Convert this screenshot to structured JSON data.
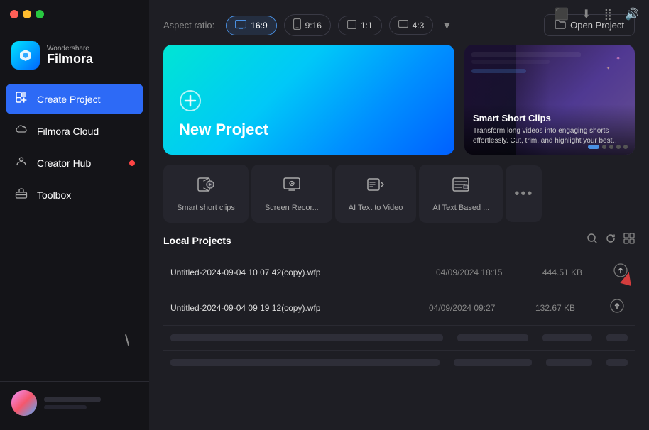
{
  "app": {
    "title": "Wondershare Filmora",
    "brand": "Wondershare",
    "product": "Filmora"
  },
  "titlebar": {
    "buttons": [
      "close",
      "minimize",
      "maximize"
    ]
  },
  "topRightIcons": [
    "screen-mirror-icon",
    "download-icon",
    "grid-icon",
    "settings-icon"
  ],
  "sidebar": {
    "items": [
      {
        "id": "create-project",
        "label": "Create Project",
        "icon": "➕",
        "active": true
      },
      {
        "id": "filmora-cloud",
        "label": "Filmora Cloud",
        "icon": "☁️",
        "active": false
      },
      {
        "id": "creator-hub",
        "label": "Creator Hub",
        "icon": "👤",
        "active": false,
        "badge": true
      },
      {
        "id": "toolbox",
        "label": "Toolbox",
        "icon": "🧰",
        "active": false
      }
    ]
  },
  "aspectRatio": {
    "label": "Aspect ratio:",
    "options": [
      {
        "id": "16-9",
        "label": "16:9",
        "active": true
      },
      {
        "id": "9-16",
        "label": "9:16",
        "active": false
      },
      {
        "id": "1-1",
        "label": "1:1",
        "active": false
      },
      {
        "id": "4-3",
        "label": "4:3",
        "active": false
      }
    ],
    "more": "▾"
  },
  "openProject": {
    "label": "Open Project",
    "icon": "📁"
  },
  "newProject": {
    "title": "New Project",
    "icon": "⊕"
  },
  "smartClipsBanner": {
    "title": "Smart Short Clips",
    "description": "Transform long videos into engaging shorts effortlessly. Cut, trim, and highlight your best…",
    "dots": 5,
    "activeDot": 0
  },
  "quickActions": [
    {
      "id": "smart-short-clips",
      "label": "Smart short clips",
      "icon": "📱"
    },
    {
      "id": "screen-recorder",
      "label": "Screen Recor...",
      "icon": "🖥"
    },
    {
      "id": "ai-text-to-video",
      "label": "AI Text to Video",
      "icon": "📝"
    },
    {
      "id": "ai-text-based",
      "label": "AI Text Based ...",
      "icon": "💬"
    },
    {
      "id": "more",
      "label": "•••",
      "icon": "•••"
    }
  ],
  "localProjects": {
    "title": "Local Projects",
    "actions": [
      "search",
      "refresh",
      "grid-view"
    ],
    "rows": [
      {
        "name": "Untitled-2024-09-04 10 07 42(copy).wfp",
        "date": "04/09/2024 18:15",
        "size": "444.51 KB",
        "highlighted": true
      },
      {
        "name": "Untitled-2024-09-04 09 19 12(copy).wfp",
        "date": "04/09/2024 09:27",
        "size": "132.67 KB",
        "highlighted": false
      }
    ]
  }
}
